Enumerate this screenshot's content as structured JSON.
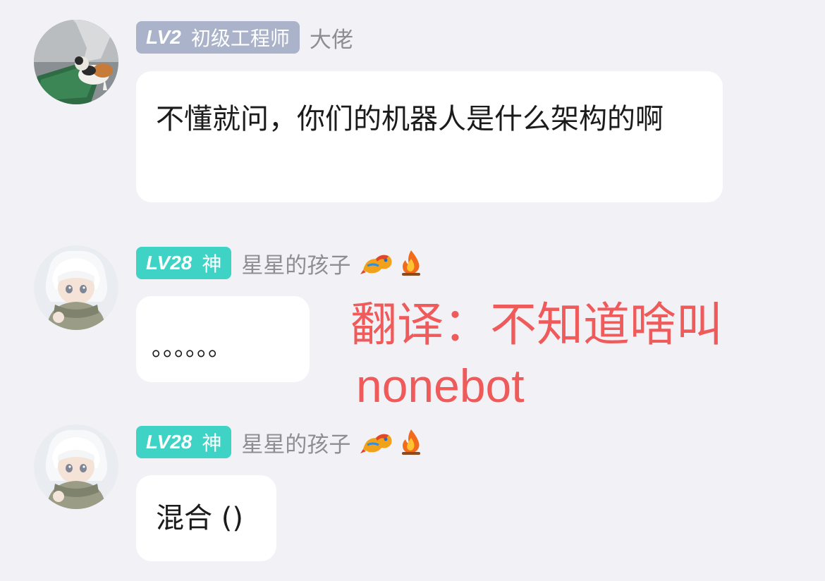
{
  "messages": [
    {
      "badge": {
        "level": "LV2",
        "title": "初级工程师",
        "color": "#aab3c9"
      },
      "nickname": "大佬",
      "text": "不懂就问，你们的机器人是什么架构的啊",
      "avatar": "cat-avatar",
      "emojis": []
    },
    {
      "badge": {
        "level": "LV28",
        "title": "神",
        "color": "#3fd3c5"
      },
      "nickname": "星星的孩子",
      "text": "。。。。。。",
      "avatar": "anime-boy-avatar",
      "emojis": [
        "dragon-icon",
        "fire-icon"
      ]
    },
    {
      "badge": {
        "level": "LV28",
        "title": "神",
        "color": "#3fd3c5"
      },
      "nickname": "星星的孩子",
      "text": "混合 ()",
      "avatar": "anime-boy-avatar",
      "emojis": [
        "dragon-icon",
        "fire-icon"
      ]
    }
  ],
  "annotation": {
    "line1": "翻译：不知道啥叫",
    "line2": "nonebot",
    "color": "#ef5a5a"
  }
}
